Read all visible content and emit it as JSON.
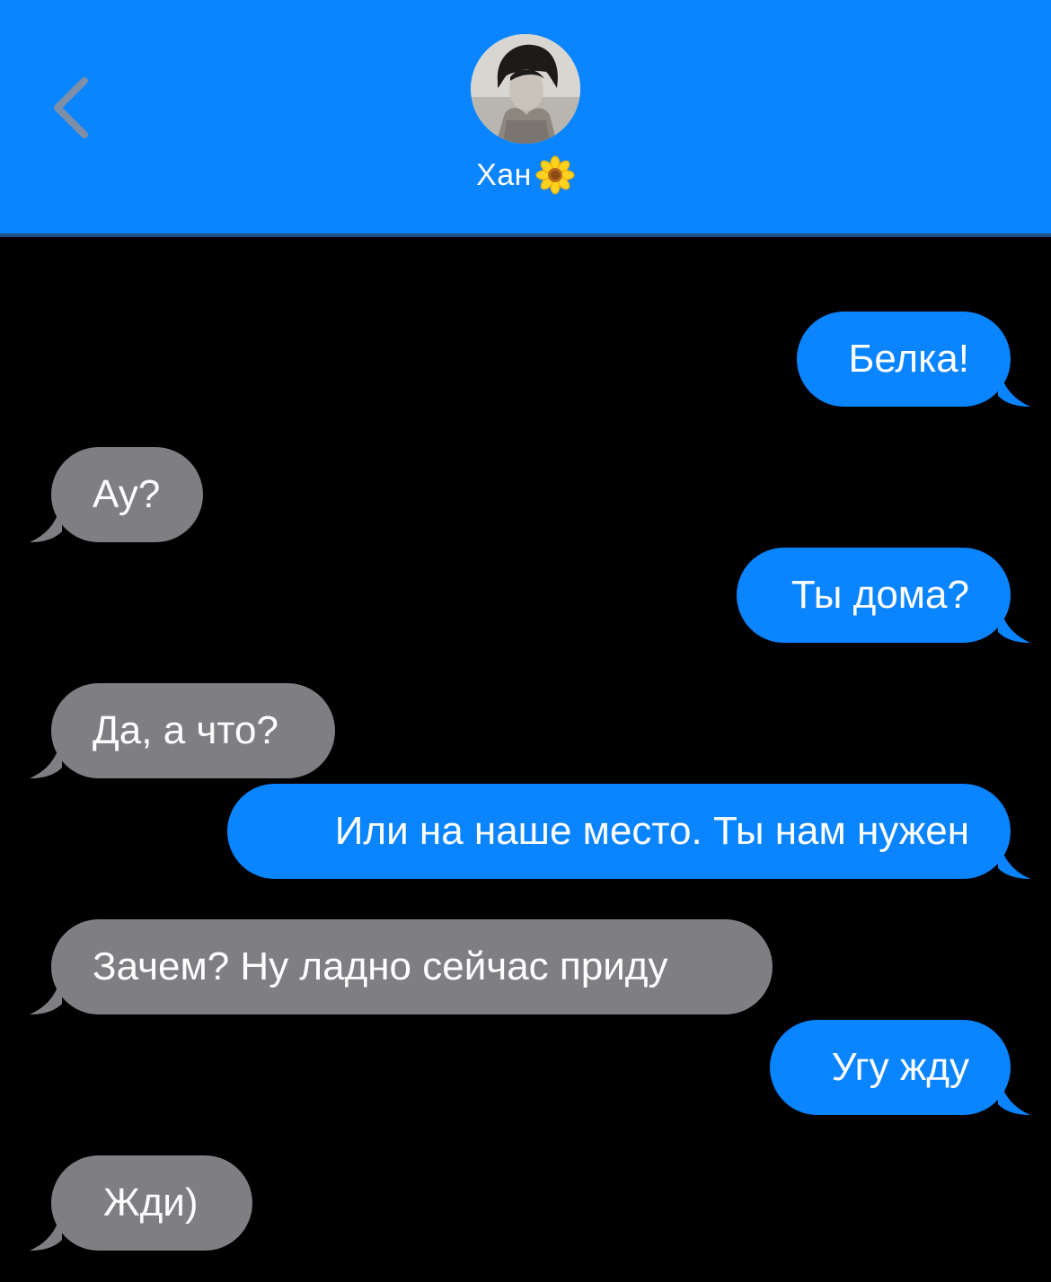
{
  "header": {
    "contact_name": "Хан",
    "contact_emoji": "sunflower-icon",
    "back_icon": "chevron-left-icon",
    "background_color": "#0a84ff"
  },
  "colors": {
    "outgoing_bubble": "#0a84ff",
    "incoming_bubble": "#7f7e83",
    "background": "#000000",
    "text": "#ffffff"
  },
  "messages": [
    {
      "direction": "outgoing",
      "text": "Белка!"
    },
    {
      "direction": "incoming",
      "text": "Ау?"
    },
    {
      "direction": "outgoing",
      "text": "Ты дома?"
    },
    {
      "direction": "incoming",
      "text": "Да, а что?"
    },
    {
      "direction": "outgoing",
      "text": "Или на наше место. Ты нам нужен"
    },
    {
      "direction": "incoming",
      "text": "Зачем? Ну ладно сейчас приду"
    },
    {
      "direction": "outgoing",
      "text": "Угу жду"
    },
    {
      "direction": "incoming",
      "text": "Жди)"
    }
  ]
}
